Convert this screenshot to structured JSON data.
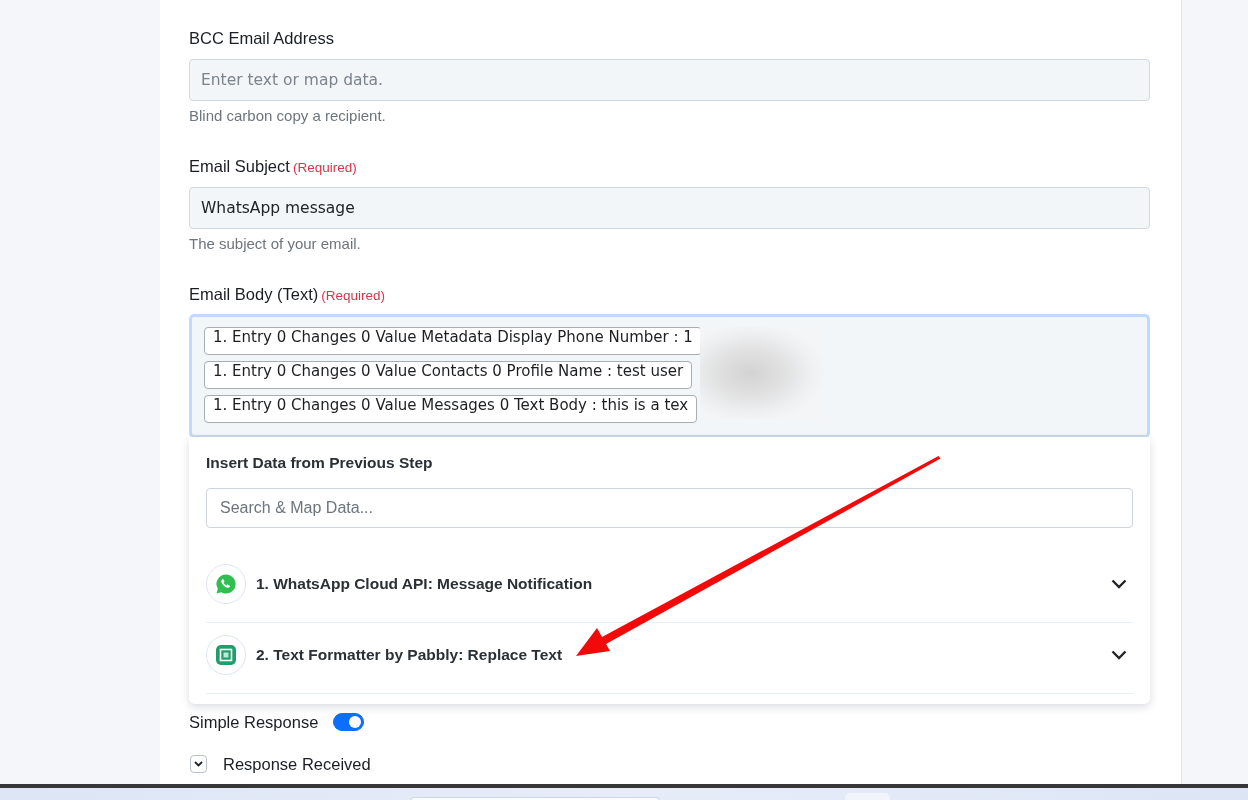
{
  "fields": [
    {
      "kind": "text",
      "label": "BCC Email Address",
      "placeholder": "Enter text or map data.",
      "help": "Blind carbon copy a recipient."
    },
    {
      "kind": "text",
      "label": "Email Subject",
      "required_tag": "(Required)",
      "value": "WhatsApp message",
      "help": "The subject of your email."
    },
    {
      "kind": "mapped",
      "label": "Email Body (Text)",
      "required_tag": "(Required)",
      "focused": true,
      "redacted": true,
      "chips": [
        "1. Entry 0 Changes 0 Value Metadata Display Phone Number : 1",
        "1. Entry 0 Changes 0 Value Contacts 0 Profile Name : test user",
        "1. Entry 0 Changes 0 Value Messages 0 Text Body : this is a tex"
      ]
    }
  ],
  "data_picker": {
    "title": "Insert Data from Previous Step",
    "search": {
      "placeholder": "Search & Map Data..."
    },
    "steps": [
      {
        "kind": "chat",
        "label": "1. WhatsApp Cloud API: Message Notification",
        "expanded": false
      },
      {
        "kind": "formatter",
        "label": "2. Text Formatter by Pabbly: Replace Text",
        "expanded": false
      }
    ]
  },
  "simple_response": {
    "label": "Simple Response",
    "on": true
  },
  "response_received": {
    "label": "Response Received",
    "expanded": false
  },
  "annotation": {
    "kind": "arrow"
  }
}
